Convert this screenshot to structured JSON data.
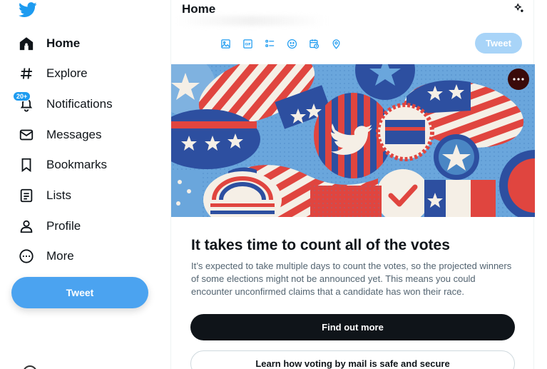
{
  "sidebar": {
    "items": [
      {
        "label": "Home",
        "icon": "home-icon"
      },
      {
        "label": "Explore",
        "icon": "hashtag-icon"
      },
      {
        "label": "Notifications",
        "icon": "bell-icon",
        "badge": "20+"
      },
      {
        "label": "Messages",
        "icon": "envelope-icon"
      },
      {
        "label": "Bookmarks",
        "icon": "bookmark-icon"
      },
      {
        "label": "Lists",
        "icon": "list-icon"
      },
      {
        "label": "Profile",
        "icon": "person-icon"
      },
      {
        "label": "More",
        "icon": "more-circle-icon"
      }
    ],
    "tweet_label": "Tweet"
  },
  "header": {
    "title": "Home"
  },
  "composer": {
    "tools": [
      "image-icon",
      "gif-icon",
      "poll-icon",
      "emoji-icon",
      "schedule-icon",
      "location-icon"
    ],
    "tweet_label": "Tweet"
  },
  "card": {
    "title": "It takes time to count all of the votes",
    "body": "It’s expected to take multiple days to count the votes, so the projected winners of some elections might not be announced yet. This means you could encounter unconfirmed claims that a candidate has won their race.",
    "primary_button": "Find out more",
    "secondary_button": "Learn how voting by mail is safe and secure"
  },
  "colors": {
    "brand": "#1d9bf0",
    "tweet_button": "#4ba3f0",
    "tweet_button_disabled": "#a8d4f8",
    "dark_button": "#0f1419",
    "flag_red": "#e0453f",
    "flag_blue": "#2d4fa0"
  }
}
